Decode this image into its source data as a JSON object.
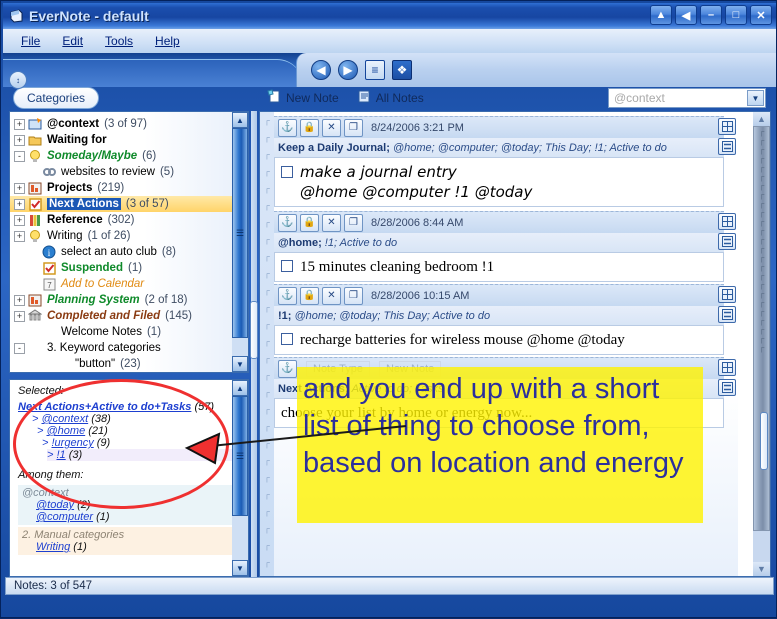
{
  "window": {
    "title": "EverNote - default",
    "app_icon": "evernote-icon",
    "controls": [
      {
        "name": "rollup-button",
        "glyph": "▲"
      },
      {
        "name": "pin-button",
        "glyph": "◀"
      },
      {
        "name": "minimize-button",
        "glyph": "–"
      },
      {
        "name": "maximize-button",
        "glyph": "□"
      },
      {
        "name": "close-button",
        "glyph": "✕"
      }
    ]
  },
  "menu": {
    "items": [
      {
        "name": "file",
        "label": "File"
      },
      {
        "name": "edit",
        "label": "Edit"
      },
      {
        "name": "tools",
        "label": "Tools"
      },
      {
        "name": "help",
        "label": "Help"
      }
    ]
  },
  "nav": {
    "icons": [
      {
        "name": "back-icon",
        "glyph": "◀"
      },
      {
        "name": "forward-icon",
        "glyph": "▶"
      },
      {
        "name": "list-view-icon",
        "glyph": "≡"
      },
      {
        "name": "bookmark-icon",
        "glyph": "❖"
      }
    ]
  },
  "categories_tab": {
    "label": "Categories",
    "collapse_icon": "↕"
  },
  "toolbar": {
    "new_note_label": "New Note",
    "new_note_icon": "new-note-icon",
    "all_notes_label": "All Notes",
    "all_notes_icon": "all-notes-icon"
  },
  "search": {
    "value": "@context",
    "placeholder": "@context",
    "dropdown_icon": "chevron-down-icon"
  },
  "tree": {
    "items": [
      {
        "expander": "+",
        "icon": "context-icon",
        "label": "@context",
        "count": "(3 of 97)",
        "style": "bold",
        "indent": 0
      },
      {
        "expander": "+",
        "icon": "folder-icon",
        "label": "Waiting for",
        "count": "",
        "style": "bold",
        "indent": 0
      },
      {
        "expander": "-",
        "icon": "bulb-icon",
        "label": "Someday/Maybe",
        "count": "(6)",
        "style": "green",
        "indent": 0
      },
      {
        "expander": "",
        "icon": "link-icon",
        "label": "websites to review",
        "count": "(5)",
        "style": "plain",
        "indent": 1
      },
      {
        "expander": "+",
        "icon": "projects-icon",
        "label": "Projects",
        "count": "(219)",
        "style": "bold",
        "indent": 0
      },
      {
        "expander": "+",
        "icon": "check-icon",
        "label": "Next Actions",
        "count": "(3 of 57)",
        "style": "selected",
        "indent": 0
      },
      {
        "expander": "+",
        "icon": "books-icon",
        "label": "Reference",
        "count": "(302)",
        "style": "bold",
        "indent": 0
      },
      {
        "expander": "+",
        "icon": "bulb-icon",
        "label": "Writing",
        "count": "(1 of 26)",
        "style": "plain",
        "indent": 0
      },
      {
        "expander": "",
        "icon": "info-icon",
        "label": "select an auto club",
        "count": "(8)",
        "style": "plain",
        "indent": 1
      },
      {
        "expander": "",
        "icon": "check-icon",
        "label": "Suspended",
        "count": "(1)",
        "style": "green-bold",
        "indent": 1
      },
      {
        "expander": "",
        "icon": "calendar-icon",
        "label": "Add to Calendar",
        "count": "",
        "style": "orange",
        "indent": 1
      },
      {
        "expander": "+",
        "icon": "projects-icon",
        "label": "Planning System",
        "count": "(2 of 18)",
        "style": "green",
        "indent": 0
      },
      {
        "expander": "+",
        "icon": "archive-icon",
        "label": "Completed and Filed",
        "count": "(145)",
        "style": "brown",
        "indent": 0
      },
      {
        "expander": "",
        "icon": "",
        "label": "Welcome Notes",
        "count": "(1)",
        "style": "plain",
        "indent": 1
      },
      {
        "expander": "-",
        "icon": "",
        "label": "3. Keyword categories",
        "count": "",
        "style": "plain",
        "indent": 0
      },
      {
        "expander": "",
        "icon": "",
        "label": "\"button\"",
        "count": "(23)",
        "style": "plain",
        "indent": 2
      }
    ]
  },
  "selected_panel": {
    "heading": "Selected:",
    "root": {
      "label": "Next Actions+Active to do+Tasks",
      "count": "(57)"
    },
    "items": [
      {
        "label": "@context",
        "count": "(38)",
        "marker": ">"
      },
      {
        "label": "@home",
        "count": "(21)",
        "marker": ">"
      },
      {
        "label": "!urgency",
        "count": "(9)",
        "marker": ">"
      },
      {
        "label": "!1",
        "count": "(3)",
        "marker": ">"
      }
    ],
    "among_heading": "Among them:",
    "groups": [
      {
        "title": "@context",
        "items": [
          {
            "label": "@today",
            "count": "(2)"
          },
          {
            "label": "@computer",
            "count": "(1)"
          }
        ]
      },
      {
        "title": "2. Manual categories",
        "items": [
          {
            "label": "Writing",
            "count": "(1)"
          }
        ]
      }
    ]
  },
  "notes": [
    {
      "buttons": [
        "attach-icon",
        "lock-icon",
        "delete-icon",
        "copy-icon"
      ],
      "date": "8/24/2006 3:21 PM",
      "title": "Keep a Daily Journal;",
      "categories": "@home; @computer; @today; This Day; !1; Active to do",
      "body_lines": [
        "make a journal entry",
        "@home @computer !1 @today"
      ],
      "body_style": "handwriting",
      "checkbox": true
    },
    {
      "buttons": [
        "attach-icon",
        "lock-icon",
        "delete-icon",
        "copy-icon"
      ],
      "date": "8/28/2006 8:44 AM",
      "title": "@home;",
      "categories": "!1; Active to do",
      "body_lines": [
        "15 minutes cleaning bedroom !1"
      ],
      "body_style": "serif",
      "checkbox": true
    },
    {
      "buttons": [
        "attach-icon",
        "lock-icon",
        "delete-icon",
        "copy-icon"
      ],
      "date": "8/28/2006 10:15 AM",
      "title": "!1;",
      "categories": "@home; @today; This Day; Active to do",
      "body_lines": [
        "recharge batteries for wireless mouse @home  @today"
      ],
      "body_style": "serif",
      "checkbox": true
    },
    {
      "buttons": [
        "attach-icon"
      ],
      "date": "",
      "title": "Next Actions;",
      "categories": "Active to do; Tasks",
      "body_lines": [
        "choose your list by home or energy now..."
      ],
      "body_style": "serif",
      "checkbox": false,
      "overlay_buttons": [
        "Note Type",
        "New Note"
      ]
    }
  ],
  "note_expand_icons": {
    "expand": "expand-icon",
    "collapse": "collapse-icon"
  },
  "callout": {
    "text": "and you end up with a short list of thing to choose from, based on location and energy",
    "background": "#fff200",
    "color": "#2b2f9e"
  },
  "annotation": {
    "ellipse_color": "#ef3030",
    "arrow_color": "#ef3030"
  },
  "status": {
    "text": "Notes: 3 of 547"
  }
}
